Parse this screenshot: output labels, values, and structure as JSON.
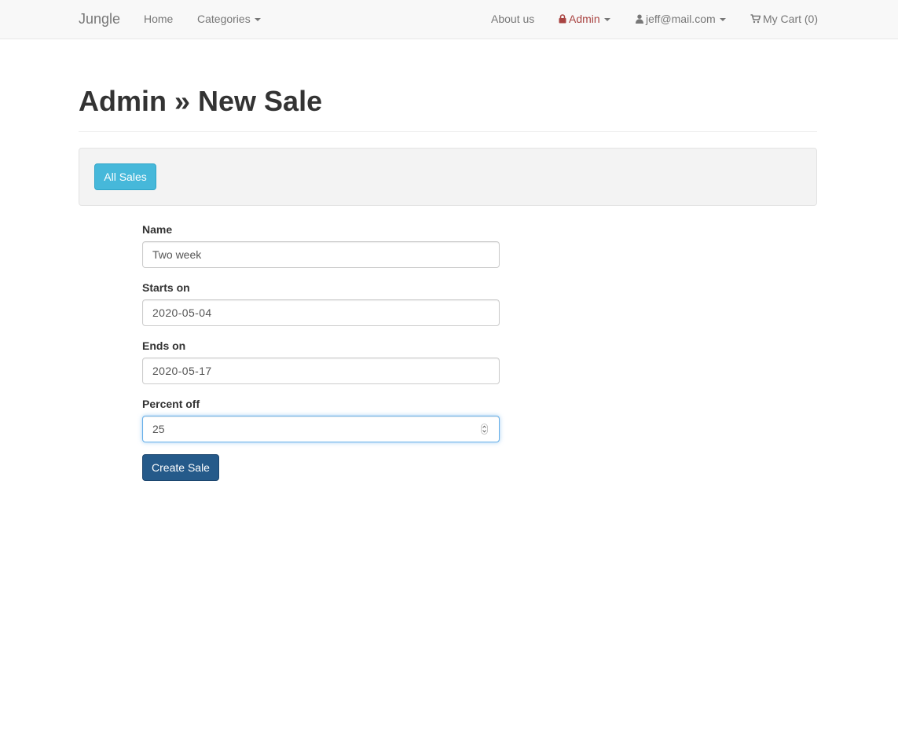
{
  "navbar": {
    "brand": "Jungle",
    "home": "Home",
    "categories": "Categories",
    "about": "About us",
    "admin": "Admin",
    "user": "jeff@mail.com",
    "cart": "My Cart (0)"
  },
  "page": {
    "title": "Admin » New Sale"
  },
  "toolbar": {
    "all_sales": "All Sales"
  },
  "form": {
    "name_label": "Name",
    "name_value": "Two week",
    "starts_label": "Starts on",
    "starts_value": "2020-05-04",
    "ends_label": "Ends on",
    "ends_value": "2020-05-17",
    "percent_label": "Percent off",
    "percent_value": "25",
    "submit": "Create Sale"
  },
  "colors": {
    "admin_accent": "#a94442",
    "info_button": "#46b8da",
    "primary_button": "#255a8a",
    "focus_border": "#66afe9"
  },
  "icons": [
    "lock-icon",
    "user-icon",
    "cart-icon",
    "caret-down-icon",
    "number-spinner-icon"
  ]
}
